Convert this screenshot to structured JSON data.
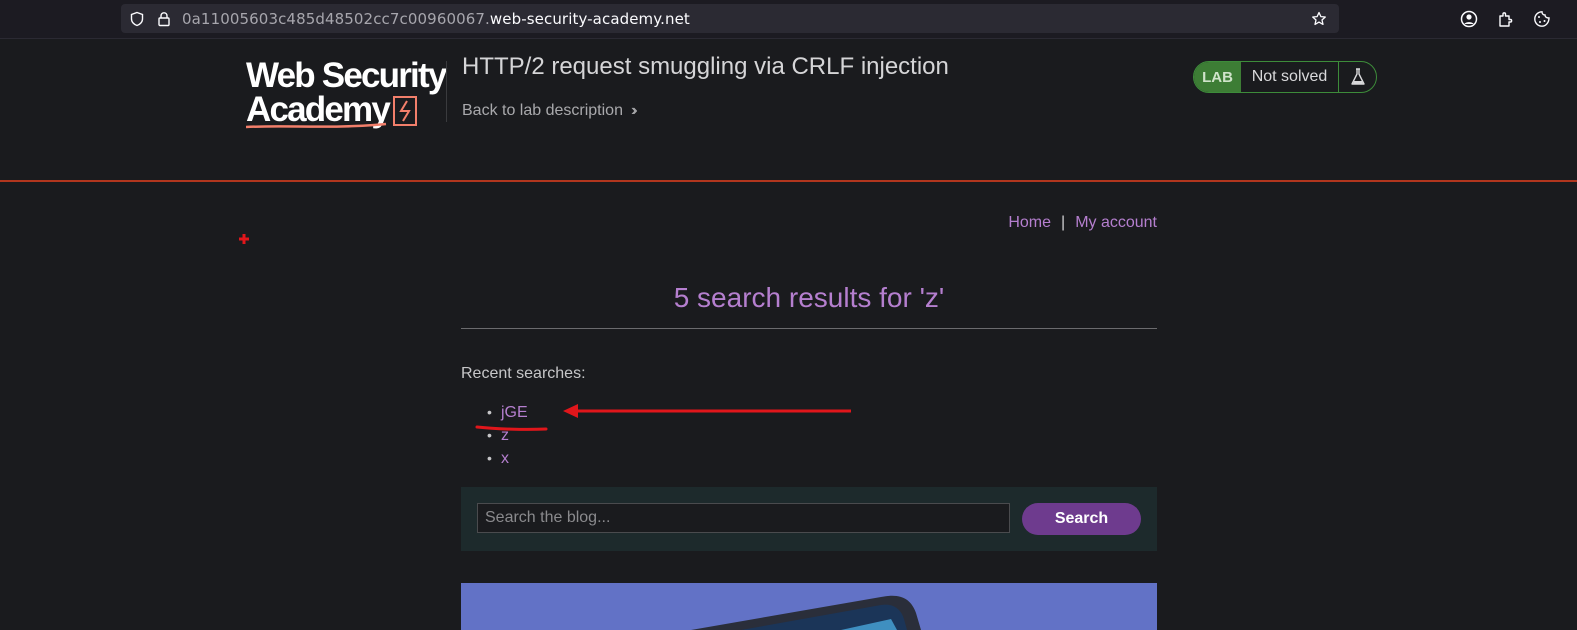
{
  "browser": {
    "url_host_prefix": "0a11005603c485d48502cc7c00960067.",
    "url_domain": "web-security-academy.net"
  },
  "header": {
    "logo_line1": "Web Security",
    "logo_line2": "Academy",
    "lab_title": "HTTP/2 request smuggling via CRLF injection",
    "back_link": "Back to lab description",
    "status_badge_label": "LAB",
    "status_text": "Not solved"
  },
  "nav": {
    "home": "Home",
    "separator": "|",
    "my_account": "My account"
  },
  "main": {
    "heading": "5 search results for 'z'",
    "recent_label": "Recent searches:",
    "recent_searches": [
      "jGE",
      "z",
      "x"
    ],
    "search_placeholder": "Search the blog...",
    "search_button": "Search"
  },
  "colors": {
    "accent_link": "#b57fcf",
    "header_rule": "#b1361e",
    "search_button": "#6e3b8e",
    "annotation": "#e0161b"
  }
}
